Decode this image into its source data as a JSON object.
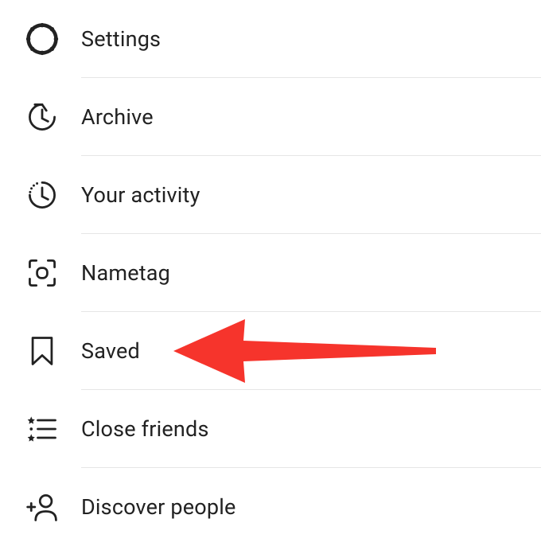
{
  "menu": {
    "items": [
      {
        "id": "settings",
        "label": "Settings",
        "icon": "gear-icon"
      },
      {
        "id": "archive",
        "label": "Archive",
        "icon": "archive-icon"
      },
      {
        "id": "your-activity",
        "label": "Your activity",
        "icon": "activity-icon"
      },
      {
        "id": "nametag",
        "label": "Nametag",
        "icon": "nametag-icon"
      },
      {
        "id": "saved",
        "label": "Saved",
        "icon": "bookmark-icon"
      },
      {
        "id": "close-friends",
        "label": "Close friends",
        "icon": "close-friends-icon"
      },
      {
        "id": "discover-people",
        "label": "Discover people",
        "icon": "discover-people-icon"
      }
    ]
  },
  "annotation": {
    "type": "arrow",
    "target": "saved",
    "color": "#f6342c"
  }
}
